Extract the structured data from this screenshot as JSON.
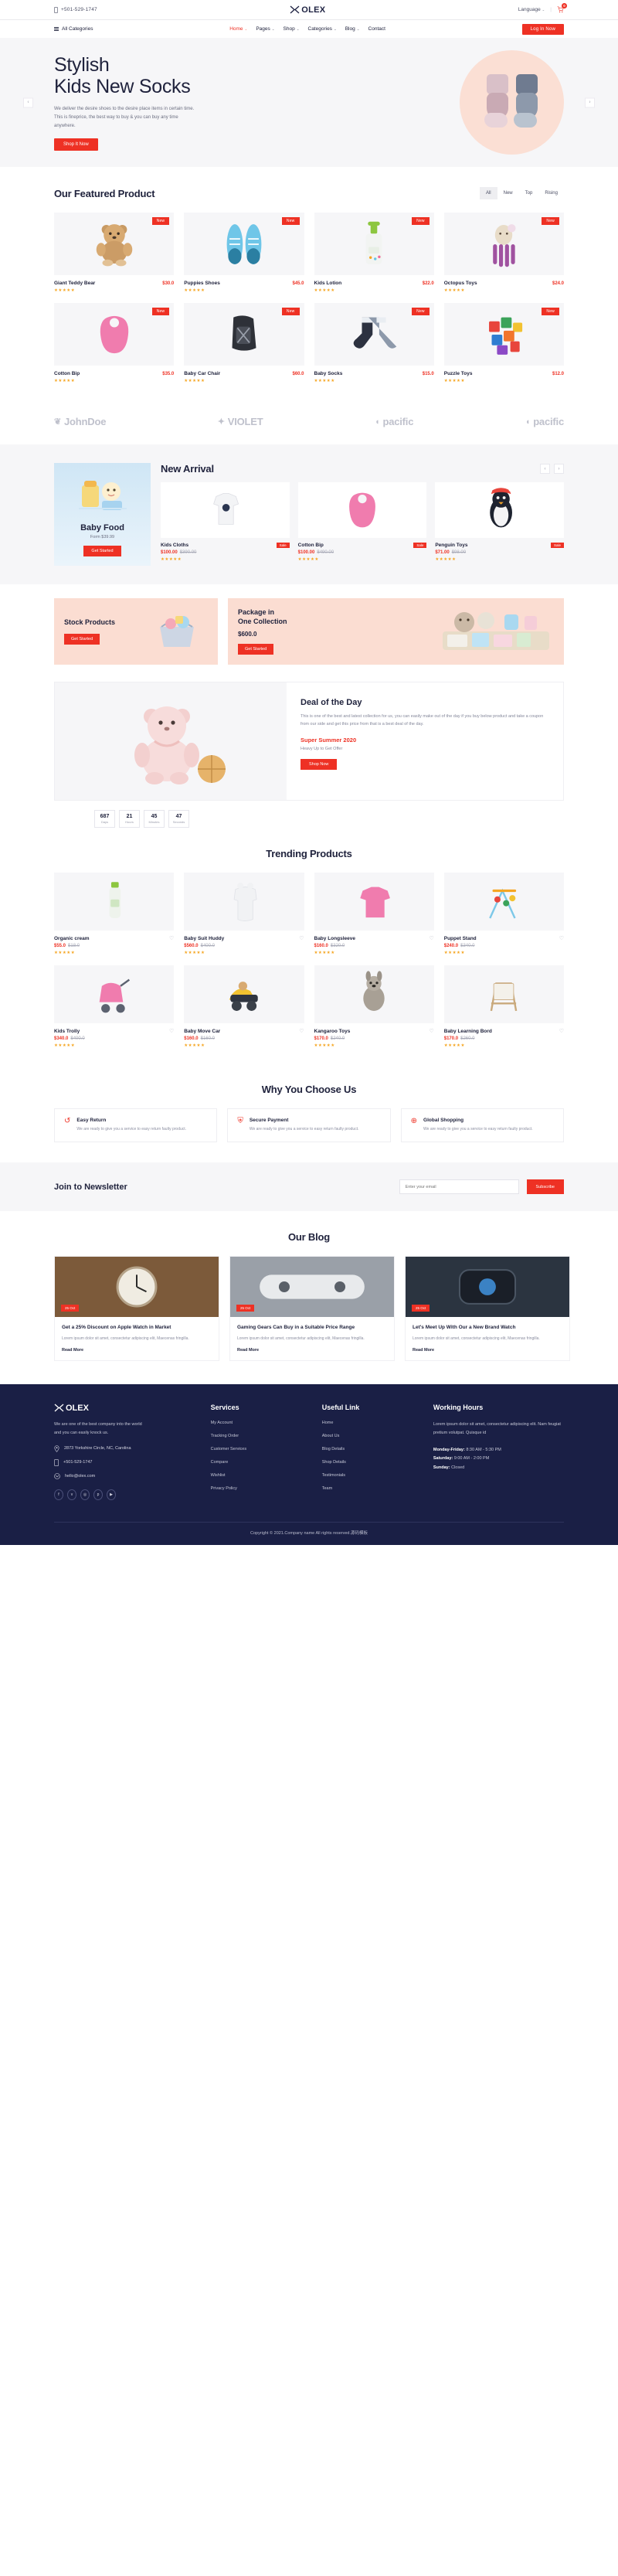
{
  "topbar": {
    "phone": "+501-529-1747",
    "logo": "OLEX",
    "language": "Language",
    "cart_count": "0",
    "phone_icon": "mobile-icon",
    "cart_icon": "cart-icon",
    "chevron_icon": "chevron-down-icon"
  },
  "nav": {
    "categories_label": "All Categories",
    "menu": [
      {
        "label": "Home",
        "caret": "⌄",
        "active": true
      },
      {
        "label": "Pages",
        "caret": "⌄",
        "active": false
      },
      {
        "label": "Shop",
        "caret": "⌄",
        "active": false
      },
      {
        "label": "Categories",
        "caret": "⌄",
        "active": false
      },
      {
        "label": "Blog",
        "caret": "⌄",
        "active": false
      },
      {
        "label": "Contact",
        "caret": "",
        "active": false
      }
    ],
    "login_label": "Log In Now"
  },
  "hero": {
    "title_line1": "Stylish",
    "title_line2": "Kids New Socks",
    "description": "We deliver the desire shoes to the desire place items in certain time. This is fineprice, the best way to buy & you can buy any time anywhere.",
    "cta": "Shop It Now",
    "prev": "‹",
    "next": "›",
    "accent": "#ee3124",
    "circle_color": "#fbdfd4"
  },
  "featured": {
    "title": "Our Featured Product",
    "filters": [
      {
        "label": "All",
        "active": true
      },
      {
        "label": "New",
        "active": false
      },
      {
        "label": "Top",
        "active": false
      },
      {
        "label": "Rising",
        "active": false
      }
    ],
    "badge": "New",
    "products": [
      {
        "name": "Giant Teddy Bear",
        "price": "$30.0",
        "stars": "★★★★★",
        "art": "bear"
      },
      {
        "name": "Puppies Shoes",
        "price": "$45.0",
        "stars": "★★★★★",
        "art": "shoes"
      },
      {
        "name": "Kids Lotion",
        "price": "$22.0",
        "stars": "★★★★★",
        "art": "lotion"
      },
      {
        "name": "Octopus Toys",
        "price": "$24.0",
        "stars": "★★★★★",
        "art": "octopus"
      },
      {
        "name": "Cotton Bip",
        "price": "$35.0",
        "stars": "★★★★★",
        "art": "bib"
      },
      {
        "name": "Baby Car Chair",
        "price": "$60.0",
        "stars": "★★★★★",
        "art": "carseat"
      },
      {
        "name": "Baby Socks",
        "price": "$15.0",
        "stars": "★★★★★",
        "art": "socks"
      },
      {
        "name": "Puzzle Toys",
        "price": "$12.0",
        "stars": "★★★★★",
        "art": "puzzle"
      }
    ]
  },
  "brands": [
    {
      "name": "JohnDoe",
      "mark": "❦"
    },
    {
      "name": "VIOLET",
      "mark": "✦"
    },
    {
      "name": "pacific",
      "mark": "◖"
    },
    {
      "name": "pacific",
      "mark": "◖"
    }
  ],
  "arrival": {
    "promo": {
      "title": "Baby Food",
      "subtitle": "Form $39.99",
      "cta": "Get Started"
    },
    "title": "New Arrival",
    "prev": "‹",
    "next": "›",
    "sale_tag": "Sale",
    "products": [
      {
        "name": "Kids Cloths",
        "price": "$100.00",
        "old": "$390.00",
        "stars": "★★★★★",
        "art": "shirt"
      },
      {
        "name": "Cotton Bip",
        "price": "$100.00",
        "old": "$490.00",
        "stars": "★★★★★",
        "art": "bib"
      },
      {
        "name": "Penguin Toys",
        "price": "$71.00",
        "old": "$98.00",
        "stars": "★★★★★",
        "art": "penguin"
      }
    ]
  },
  "promos": [
    {
      "title_line1": "Stock Products",
      "title_line2": "",
      "price": "",
      "cta": "Get Started",
      "art": "basket"
    },
    {
      "title_line1": "Package in",
      "title_line2": "One Collection",
      "price": "$600.0",
      "cta": "Get Started",
      "art": "bundle"
    }
  ],
  "deal": {
    "title": "Deal of the Day",
    "description": "This is one of the best and latest collection for us, you can easily make out of the day if you buy below product and take a coupon from our side and get this price from that is a best deal of the day.",
    "subtitle": "Super Summer 2020",
    "note": "Heavy Up to Get Offer",
    "cta": "Shop Now",
    "timer": [
      {
        "value": "687",
        "label": "Days"
      },
      {
        "value": "21",
        "label": "Hours"
      },
      {
        "value": "45",
        "label": "Minutes"
      },
      {
        "value": "47",
        "label": "Seconds"
      }
    ]
  },
  "trending": {
    "title": "Trending Products",
    "heart_icon": "heart-icon",
    "products": [
      {
        "name": "Organic cream",
        "price": "$55.0",
        "old": "$18.0",
        "stars": "★★★★★",
        "art": "cream"
      },
      {
        "name": "Baby Suit Huddy",
        "price": "$560.0",
        "old": "$400.0",
        "stars": "★★★★★",
        "art": "suit"
      },
      {
        "name": "Baby Longsleeve",
        "price": "$160.0",
        "old": "$320.0",
        "stars": "★★★★★",
        "art": "longsleeve"
      },
      {
        "name": "Puppet Stand",
        "price": "$240.0",
        "old": "$340.0",
        "stars": "★★★★★",
        "art": "puppetstand"
      },
      {
        "name": "Kids Trolly",
        "price": "$340.0",
        "old": "$400.0",
        "stars": "★★★★★",
        "art": "trolley"
      },
      {
        "name": "Baby Move Car",
        "price": "$160.0",
        "old": "$160.0",
        "stars": "★★★★★",
        "art": "movecar"
      },
      {
        "name": "Kangaroo Toys",
        "price": "$170.0",
        "old": "$240.0",
        "stars": "★★★★★",
        "art": "kangaroo"
      },
      {
        "name": "Baby Learning Bord",
        "price": "$170.0",
        "old": "$260.0",
        "stars": "★★★★★",
        "art": "board"
      }
    ]
  },
  "why": {
    "title": "Why You Choose Us",
    "cards": [
      {
        "icon": "return-icon",
        "glyph": "↺",
        "title": "Easy Return",
        "desc": "We are ready to give you a service to easy return faulty product."
      },
      {
        "icon": "shield-icon",
        "glyph": "⛨",
        "title": "Secure Payment",
        "desc": "We are ready to give you a service to easy return faulty product."
      },
      {
        "icon": "globe-icon",
        "glyph": "⊕",
        "title": "Global Shopping",
        "desc": "We are ready to give you a service to easy return faulty product."
      }
    ]
  },
  "newsletter": {
    "title": "Join to Newsletter",
    "placeholder": "Enter your email",
    "button": "Subscribe"
  },
  "blog": {
    "title": "Our Blog",
    "posts": [
      {
        "date": "25 Oct",
        "title": "Get a 25% Discount on Apple Watch in Market",
        "desc": "Lorem ipsum dolor sit amet, consectetur adipiscing elit, Maecenas fringilla.",
        "more": "Read More",
        "art": "watch"
      },
      {
        "date": "25 Oct",
        "title": "Gaming Gears Can Buy in a Suitable Price Range",
        "desc": "Lorem ipsum dolor sit amet, consectetur adipiscing elit, Maecenas fringilla.",
        "more": "Read More",
        "art": "gamepad"
      },
      {
        "date": "25 Oct",
        "title": "Let's Meet Up With Our a New Brand Watch",
        "desc": "Lorem ipsum dolor sit amet, consectetur adipiscing elit, Maecenas fringilla.",
        "more": "Read More",
        "art": "smartwatch"
      }
    ]
  },
  "footer": {
    "logo": "OLEX",
    "desc": "We are one of the best company into the world and you can easily knock us.",
    "address": "2873 Yorkshire Circle, NC, Carolina",
    "phone": "+501-529-1747",
    "email": "hello@olex.com",
    "socials": [
      {
        "name": "facebook-icon",
        "glyph": "f"
      },
      {
        "name": "twitter-icon",
        "glyph": "ᴠ"
      },
      {
        "name": "instagram-icon",
        "glyph": "◎"
      },
      {
        "name": "pinterest-icon",
        "glyph": "p"
      },
      {
        "name": "youtube-icon",
        "glyph": "▶"
      }
    ],
    "services_head": "Services",
    "services": [
      "My Account",
      "Tracking Order",
      "Customer Services",
      "Compare",
      "Wishlist",
      "Privacy Policy"
    ],
    "useful_head": "Useful Link",
    "useful": [
      "Home",
      "About Us",
      "Blog Details",
      "Shop Details",
      "Testimonials",
      "Team"
    ],
    "hours_head": "Working Hours",
    "hours_desc": "Lorem ipsum dolor sit amet, consectetur adipiscing elit. Nam feugiat pretium volutpat. Quisque id",
    "hours": [
      {
        "day": "Monday-Friday:",
        "time": " 8:30 AM - 5:30 PM"
      },
      {
        "day": "Saturday:",
        "time": " 9:00 AM - 2:00 PM"
      },
      {
        "day": "Sunday:",
        "time": " Closed"
      }
    ],
    "copyright": "Copyright © 2021.Company name All rights reserved.源码模板"
  }
}
